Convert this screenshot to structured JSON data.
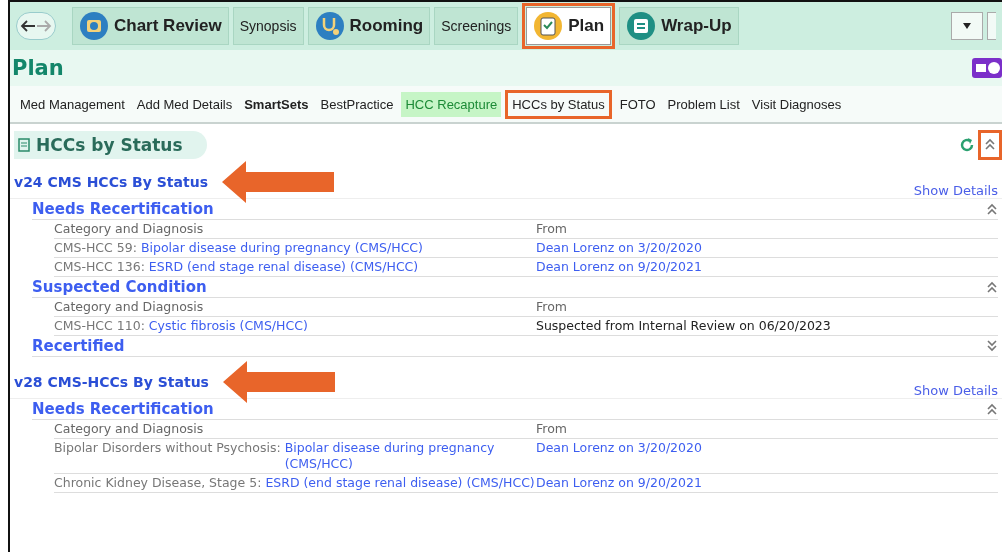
{
  "tabs": [
    {
      "label": "Chart Review",
      "kind": "big",
      "selected": false,
      "annotated": false
    },
    {
      "label": "Synopsis",
      "kind": "small",
      "selected": false,
      "annotated": false
    },
    {
      "label": "Rooming",
      "kind": "big",
      "selected": false,
      "annotated": false
    },
    {
      "label": "Screenings",
      "kind": "small",
      "selected": false,
      "annotated": false
    },
    {
      "label": "Plan",
      "kind": "big",
      "selected": true,
      "annotated": true
    },
    {
      "label": "Wrap-Up",
      "kind": "big",
      "selected": false,
      "annotated": false
    }
  ],
  "page_title": "Plan",
  "nav": [
    {
      "label": "Med Management",
      "kind": "plain",
      "annotated": false
    },
    {
      "label": "Add Med Details",
      "kind": "plain",
      "annotated": false
    },
    {
      "label": "SmartSets",
      "kind": "bold",
      "annotated": false
    },
    {
      "label": "BestPractice",
      "kind": "plain",
      "annotated": false
    },
    {
      "label": "HCC Recapture",
      "kind": "flagged",
      "annotated": false
    },
    {
      "label": "HCCs by Status",
      "kind": "plain",
      "annotated": true
    },
    {
      "label": "FOTO",
      "kind": "plain",
      "annotated": false
    },
    {
      "label": "Problem List",
      "kind": "plain",
      "annotated": false
    },
    {
      "label": "Visit Diagnoses",
      "kind": "plain",
      "annotated": false
    }
  ],
  "section": {
    "title": "HCCs by Status",
    "collapse_annotated": true
  },
  "groups": [
    {
      "title": "v24 CMS HCCs By Status",
      "arrow": true,
      "details_link": "Show Details",
      "subsections": [
        {
          "title": "Needs Recertification",
          "expanded": true,
          "columns": [
            "Category and Diagnosis",
            "From"
          ],
          "rows": [
            {
              "code": "CMS-HCC 59:",
              "diagnosis": "Bipolar disease during pregnancy (CMS/HCC)",
              "from": "Dean Lorenz on 3/20/2020",
              "kind": "link"
            },
            {
              "code": "CMS-HCC 136:",
              "diagnosis": "ESRD (end stage renal disease) (CMS/HCC)",
              "from": "Dean Lorenz on 9/20/2021",
              "kind": "link"
            }
          ]
        },
        {
          "title": "Suspected Condition",
          "expanded": true,
          "columns": [
            "Category and Diagnosis",
            "From"
          ],
          "rows": [
            {
              "code": "CMS-HCC 110:",
              "diagnosis": "Cystic fibrosis (CMS/HCC)",
              "from": "Suspected from Internal Review on 06/20/2023",
              "kind": "text"
            }
          ]
        },
        {
          "title": "Recertified",
          "expanded": false
        }
      ]
    },
    {
      "title": "v28 CMS-HCCs By Status",
      "arrow": true,
      "details_link": "Show Details",
      "subsections": [
        {
          "title": "Needs Recertification",
          "expanded": true,
          "columns": [
            "Category and Diagnosis",
            "From"
          ],
          "rows": [
            {
              "code": "Bipolar Disorders without Psychosis:",
              "diagnosis": "Bipolar disease during pregnancy (CMS/HCC)",
              "from": "Dean Lorenz on 3/20/2020",
              "kind": "link"
            },
            {
              "code": "Chronic Kidney Disease, Stage 5:",
              "diagnosis": "ESRD (end stage renal disease) (CMS/HCC)",
              "from": "Dean Lorenz on 9/20/2021",
              "kind": "link"
            }
          ]
        }
      ]
    }
  ]
}
